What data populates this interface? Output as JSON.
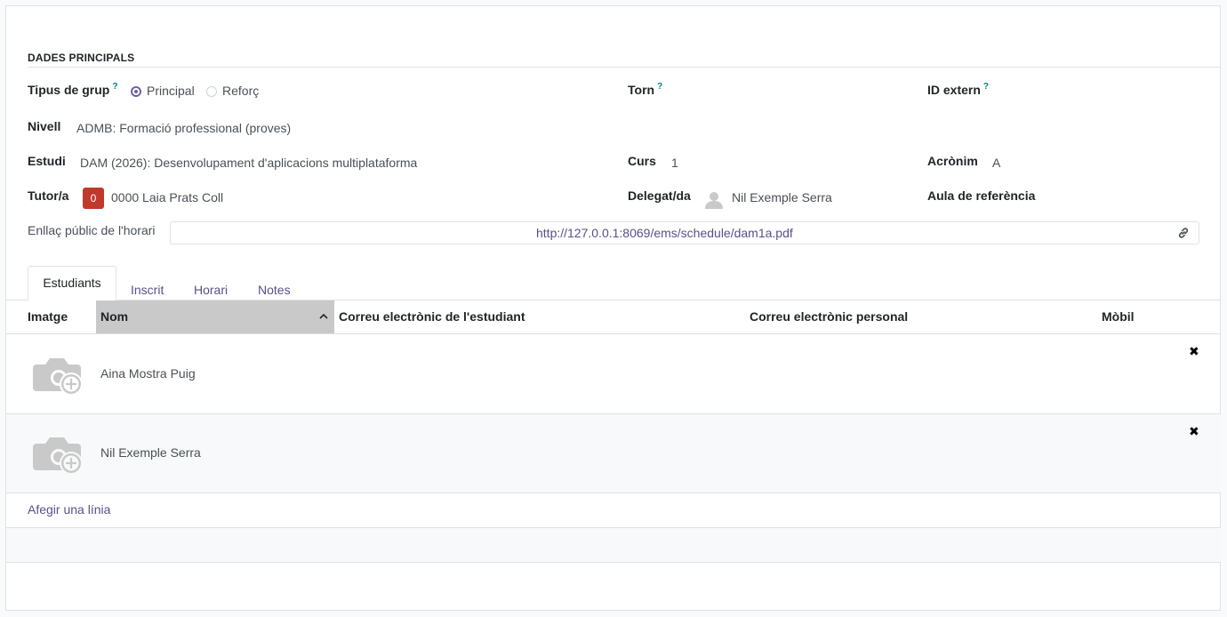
{
  "section": {
    "title": "DADES PRINCIPALS"
  },
  "fields": {
    "group_type": {
      "label": "Tipus de grup",
      "help": "?",
      "options": [
        "Principal",
        "Reforç"
      ],
      "selected": "Principal"
    },
    "shift": {
      "label": "Torn",
      "help": "?",
      "value": ""
    },
    "external_id": {
      "label": "ID extern",
      "help": "?",
      "value": ""
    },
    "level": {
      "label": "Nivell",
      "value": "ADMB: Formació professional (proves)"
    },
    "study": {
      "label": "Estudi",
      "value": "DAM (2026): Desenvolupament d'aplicacions multiplataforma"
    },
    "course": {
      "label": "Curs",
      "value": "1"
    },
    "acronym": {
      "label": "Acrònim",
      "value": "A"
    },
    "tutor": {
      "label": "Tutor/a",
      "badge": "0",
      "value": "0000 Laia Prats Coll"
    },
    "delegate": {
      "label": "Delegat/da",
      "value": "Nil Exemple Serra"
    },
    "classroom": {
      "label": "Aula de referència",
      "value": ""
    },
    "schedule_link": {
      "label": "Enllaç públic de l'horari",
      "value": "http://127.0.0.1:8069/ems/schedule/dam1a.pdf"
    }
  },
  "tabs": [
    "Estudiants",
    "Inscrit",
    "Horari",
    "Notes"
  ],
  "active_tab": "Estudiants",
  "table": {
    "columns": [
      "Imatge",
      "Nom",
      "Correu electrònic de l'estudiant",
      "Correu electrònic personal",
      "Mòbil"
    ],
    "sorted_column": "Nom",
    "rows": [
      {
        "name": "Aina Mostra Puig",
        "student_email": "",
        "personal_email": "",
        "mobile": ""
      },
      {
        "name": "Nil Exemple Serra",
        "student_email": "",
        "personal_email": "",
        "mobile": ""
      }
    ],
    "add_line": "Afegir una línia",
    "delete_glyph": "✖"
  },
  "icons": {
    "camera": "camera-plus-icon",
    "link": "link-icon",
    "sort": "chevron-up-icon",
    "avatar": "user-avatar-icon",
    "delete": "delete-row-icon"
  },
  "colors": {
    "accent": "#71639e",
    "link": "#5b4f8a",
    "help": "#017e84",
    "badge": "#c0392b"
  }
}
